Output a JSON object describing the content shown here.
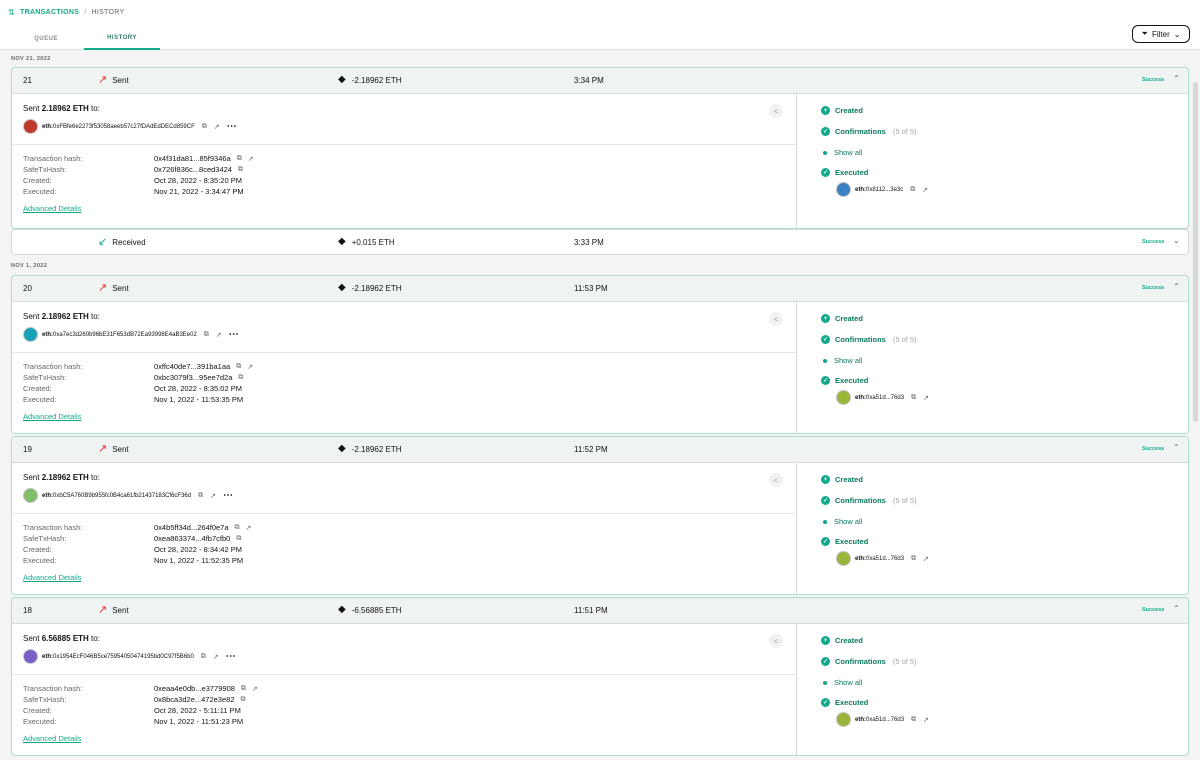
{
  "breadcrumb": {
    "icon": "transactions-icon",
    "primary": "TRANSACTIONS",
    "separator": "/",
    "current": "HISTORY"
  },
  "tabs": [
    {
      "label": "QUEUE"
    },
    {
      "label": "HISTORY"
    }
  ],
  "filter": {
    "label": "Filter"
  },
  "colors": {
    "accent": "#12a88a",
    "sent_arrow": "#f02525",
    "header_bg": "#eff3f2"
  },
  "dates": {
    "group1": "NOV 21, 2022",
    "group2": "NOV 1, 2022"
  },
  "details_labels": {
    "tx_hash": "Transaction hash:",
    "safe_hash": "SafeTxHash:",
    "created": "Created:",
    "executed": "Executed:",
    "advanced": "Advanced Details"
  },
  "steps": {
    "created": "Created",
    "confirmations": "Confirmations",
    "confirm_count": "(5 of 5)",
    "show_all": "Show all",
    "executed": "Executed"
  },
  "received_row": {
    "type": "Received",
    "amount": "+0.015 ETH",
    "time": "3:33 PM",
    "status": "Success"
  },
  "cards": [
    {
      "nonce": "21",
      "type": "Sent",
      "amount": "-2.18962 ETH",
      "time": "3:34 PM",
      "status": "Success",
      "sent_prefix": "Sent ",
      "sent_amount": "2.18962 ETH",
      "sent_suffix": " to:",
      "addr_prefix": "eth:",
      "address": "0xFBfe6e2273f53058aeeb57c27fDAdEdDECd859CF",
      "tx_hash": "0x4f31da81...85f9346a",
      "safe_hash": "0x726f836c...8ced3424",
      "created": "Oct 28, 2022 - 8:35:20 PM",
      "executed_at": "Nov 21, 2022 - 3:34:47 PM",
      "executor_prefix": "eth:",
      "executor": "0x8112...3e3c",
      "avatar_color": "#c0392b",
      "exec_avatar_color": "#3b7fc4"
    },
    {
      "nonce": "20",
      "type": "Sent",
      "amount": "-2.18962 ETH",
      "time": "11:53 PM",
      "status": "Success",
      "sent_prefix": "Sent ",
      "sent_amount": "2.18962 ETH",
      "sent_suffix": " to:",
      "addr_prefix": "eth:",
      "address": "0xa7ec3d260b96bE31F653dB72Ea93998E4aB3Ee02",
      "tx_hash": "0xffc40de7...391ba1aa",
      "safe_hash": "0xbc3079f3...95ee7d2a",
      "created": "Oct 28, 2022 - 8:35:02 PM",
      "executed_at": "Nov 1, 2022 - 11:53:35 PM",
      "executor_prefix": "eth:",
      "executor": "0xa51d...76d3",
      "avatar_color": "#17a2b8",
      "exec_avatar_color": "#9bb53a"
    },
    {
      "nonce": "19",
      "type": "Sent",
      "amount": "-2.18962 ETH",
      "time": "11:52 PM",
      "status": "Success",
      "sent_prefix": "Sent ",
      "sent_amount": "2.18962 ETH",
      "sent_suffix": " to:",
      "addr_prefix": "eth:",
      "address": "0xbC5A760B9b955fc0B4ca61fb21437183Cf6cF36d",
      "tx_hash": "0x4b5ff34d...264f0e7a",
      "safe_hash": "0xea863374...4fb7cfb0",
      "created": "Oct 28, 2022 - 8:34:42 PM",
      "executed_at": "Nov 1, 2022 - 11:52:35 PM",
      "executor_prefix": "eth:",
      "executor": "0xa51d...76d3",
      "avatar_color": "#7fbf6a",
      "exec_avatar_color": "#9bb53a"
    },
    {
      "nonce": "18",
      "type": "Sent",
      "amount": "-6.56885 ETH",
      "time": "11:51 PM",
      "status": "Success",
      "sent_prefix": "Sent ",
      "sent_amount": "6.56885 ETH",
      "sent_suffix": " to:",
      "addr_prefix": "eth:",
      "address": "0x1954EcF046B5ce75954050474195bd0C97f5B6b0",
      "tx_hash": "0xeaa4e0db...e3779908",
      "safe_hash": "0x8bca3d2e...472e3e82",
      "created": "Oct 28, 2022 - 5:11:11 PM",
      "executed_at": "Nov 1, 2022 - 11:51:23 PM",
      "executor_prefix": "eth:",
      "executor": "0xa51d...76d3",
      "avatar_color": "#7b5fc9",
      "exec_avatar_color": "#9bb53a"
    }
  ]
}
